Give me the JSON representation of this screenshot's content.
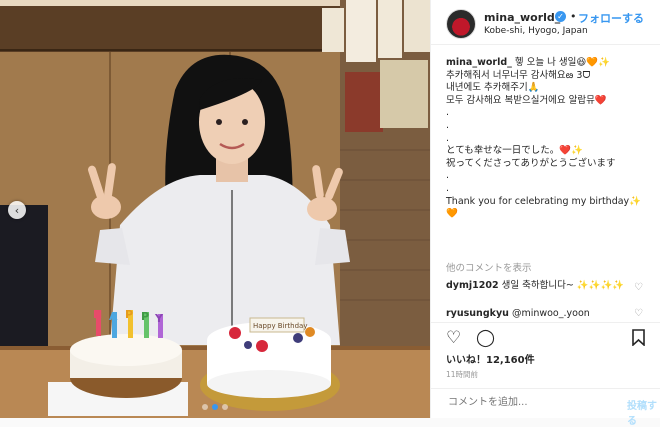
{
  "photo": {
    "cake_letters": [
      "H",
      "A",
      "P",
      "P",
      "Y"
    ],
    "plate_text": "Happy Birthday"
  },
  "header": {
    "username": "mina_world_",
    "verified_mark": "✓",
    "separator": "•",
    "follow_label": "フォローする",
    "location": "Kobe-shi, Hyogo, Japan"
  },
  "caption": {
    "username": "mina_world_",
    "lines": [
      "헿 오늘 나 생일😆🧡✨",
      "추카해줘서 너무너무 감사해요ఴ 3ᗜ",
      "내년에도 추카해주기🙏",
      "모두 감사해요 복받으실거에요 알랍뮤❤️",
      ".",
      ".",
      ".",
      "とても幸せな一日でした。❤️✨",
      "祝ってくださってありがとうございます",
      ".",
      ".",
      "Thank you for celebrating my birthday✨",
      "🧡"
    ]
  },
  "more_comments": "他のコメントを表示",
  "comments": [
    {
      "username": "dymj1202",
      "text": "생일 축하합니다~ ✨✨✨✨"
    },
    {
      "username": "ryusungkyu",
      "text": "@minwoo_.yoon"
    }
  ],
  "likes": {
    "label": "いいね！",
    "count": "12,160件"
  },
  "timestamp": "11時間前",
  "add_comment": {
    "placeholder": "コメントを追加...",
    "post_label": "投稿する"
  }
}
